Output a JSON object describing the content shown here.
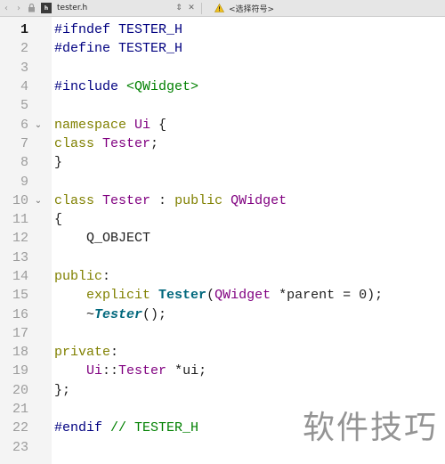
{
  "toolbar": {
    "file_icon_text": "h",
    "file_name": "tester.h",
    "symbol_select": "<选择符号>"
  },
  "lines": [
    {
      "n": "1",
      "fold": "",
      "current": true,
      "tokens": [
        [
          "mac",
          "#ifndef TESTER_H"
        ]
      ]
    },
    {
      "n": "2",
      "fold": "",
      "tokens": [
        [
          "mac",
          "#define TESTER_H"
        ]
      ]
    },
    {
      "n": "3",
      "fold": "",
      "tokens": []
    },
    {
      "n": "4",
      "fold": "",
      "tokens": [
        [
          "mac",
          "#include "
        ],
        [
          "str",
          "<QWidget>"
        ]
      ]
    },
    {
      "n": "5",
      "fold": "",
      "tokens": []
    },
    {
      "n": "6",
      "fold": "v",
      "tokens": [
        [
          "kw",
          "namespace"
        ],
        [
          "plain",
          " "
        ],
        [
          "cls",
          "Ui"
        ],
        [
          "plain",
          " {"
        ]
      ]
    },
    {
      "n": "7",
      "fold": "",
      "tokens": [
        [
          "kw",
          "class"
        ],
        [
          "plain",
          " "
        ],
        [
          "cls",
          "Tester"
        ],
        [
          "plain",
          ";"
        ]
      ]
    },
    {
      "n": "8",
      "fold": "",
      "tokens": [
        [
          "plain",
          "}"
        ]
      ]
    },
    {
      "n": "9",
      "fold": "",
      "tokens": []
    },
    {
      "n": "10",
      "fold": "v",
      "tokens": [
        [
          "kw",
          "class"
        ],
        [
          "plain",
          " "
        ],
        [
          "cls",
          "Tester"
        ],
        [
          "plain",
          " : "
        ],
        [
          "kw",
          "public"
        ],
        [
          "plain",
          " "
        ],
        [
          "cls",
          "QWidget"
        ]
      ]
    },
    {
      "n": "11",
      "fold": "",
      "tokens": [
        [
          "plain",
          "{"
        ]
      ]
    },
    {
      "n": "12",
      "fold": "",
      "tokens": [
        [
          "plain",
          "    Q_OBJECT"
        ]
      ]
    },
    {
      "n": "13",
      "fold": "",
      "tokens": []
    },
    {
      "n": "14",
      "fold": "",
      "tokens": [
        [
          "kw",
          "public"
        ],
        [
          "plain",
          ":"
        ]
      ]
    },
    {
      "n": "15",
      "fold": "",
      "tokens": [
        [
          "plain",
          "    "
        ],
        [
          "kw",
          "explicit"
        ],
        [
          "plain",
          " "
        ],
        [
          "fn",
          "Tester"
        ],
        [
          "plain",
          "("
        ],
        [
          "cls",
          "QWidget"
        ],
        [
          "plain",
          " *parent = 0);"
        ]
      ]
    },
    {
      "n": "16",
      "fold": "",
      "tokens": [
        [
          "plain",
          "    ~"
        ],
        [
          "fni",
          "Tester"
        ],
        [
          "plain",
          "();"
        ]
      ]
    },
    {
      "n": "17",
      "fold": "",
      "tokens": []
    },
    {
      "n": "18",
      "fold": "",
      "tokens": [
        [
          "kw",
          "private"
        ],
        [
          "plain",
          ":"
        ]
      ]
    },
    {
      "n": "19",
      "fold": "",
      "tokens": [
        [
          "plain",
          "    "
        ],
        [
          "cls",
          "Ui"
        ],
        [
          "plain",
          "::"
        ],
        [
          "cls",
          "Tester"
        ],
        [
          "plain",
          " *ui;"
        ]
      ]
    },
    {
      "n": "20",
      "fold": "",
      "tokens": [
        [
          "plain",
          "};"
        ]
      ]
    },
    {
      "n": "21",
      "fold": "",
      "tokens": []
    },
    {
      "n": "22",
      "fold": "",
      "tokens": [
        [
          "mac",
          "#endif"
        ],
        [
          "plain",
          " "
        ],
        [
          "cmt",
          "// TESTER_H"
        ]
      ]
    },
    {
      "n": "23",
      "fold": "",
      "tokens": []
    }
  ],
  "watermark": "软件技巧"
}
